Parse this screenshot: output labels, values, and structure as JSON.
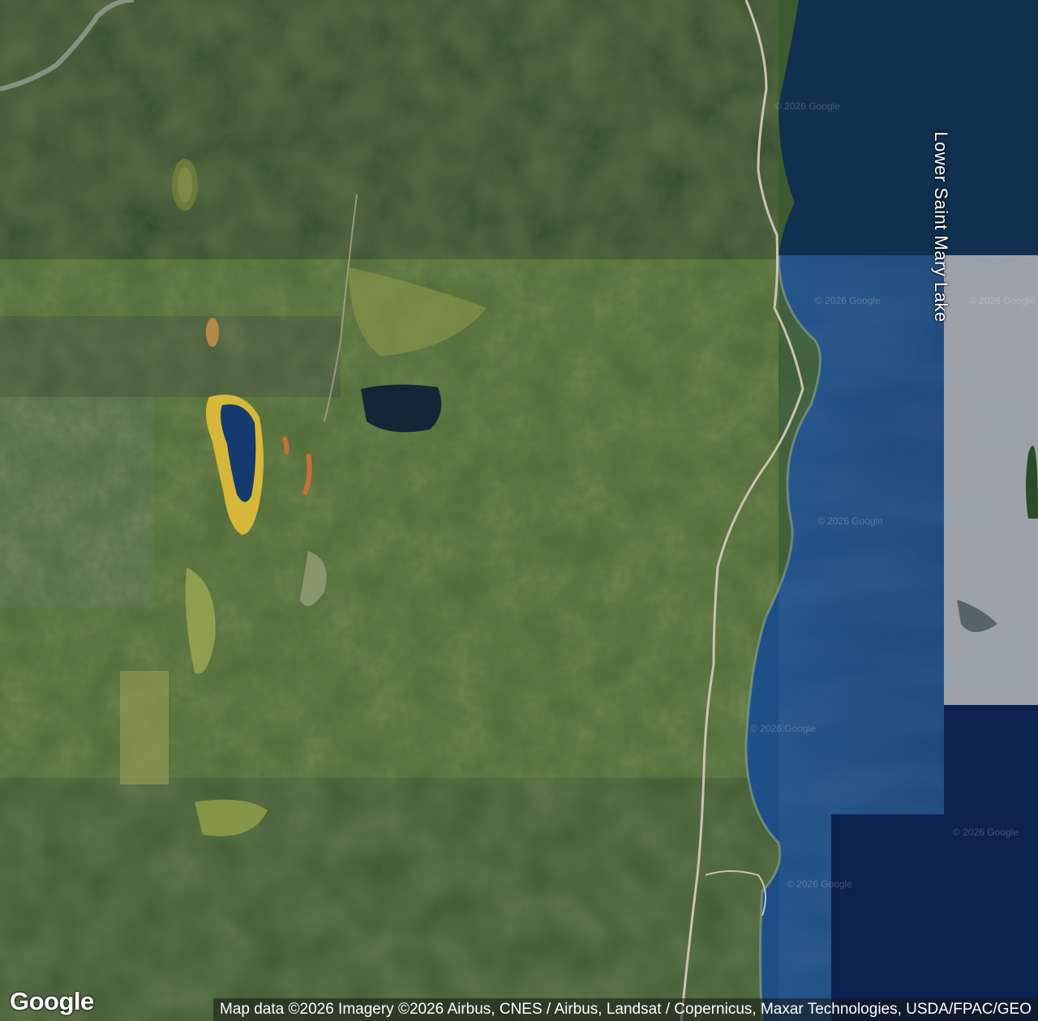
{
  "map": {
    "type": "satellite",
    "labels": {
      "lake": "Lower Saint Mary Lake"
    },
    "watermarks": [
      "© 2026 Google",
      "© 2026 Google",
      "© 2026 Google",
      "© 2026 Google",
      "© 2026 Google",
      "© 2026 Google",
      "© 2026 Google"
    ],
    "logo": "Google",
    "attribution": "Map data ©2026 Imagery ©2026 Airbus, CNES / Airbus, Landsat / Copernicus, Maxar Technologies, USDA/FPAC/GEO"
  },
  "colors": {
    "forest_dark": "#2c4127",
    "forest_mid": "#3f5b2f",
    "forest_light": "#6b8a3c",
    "meadow": "#9aa84a",
    "lake_deep": "#0d2348",
    "lake_mid": "#1b4779",
    "lake_light": "#2a5d94",
    "pond_rim": "#d6b73a",
    "road": "#c9c3b0"
  }
}
